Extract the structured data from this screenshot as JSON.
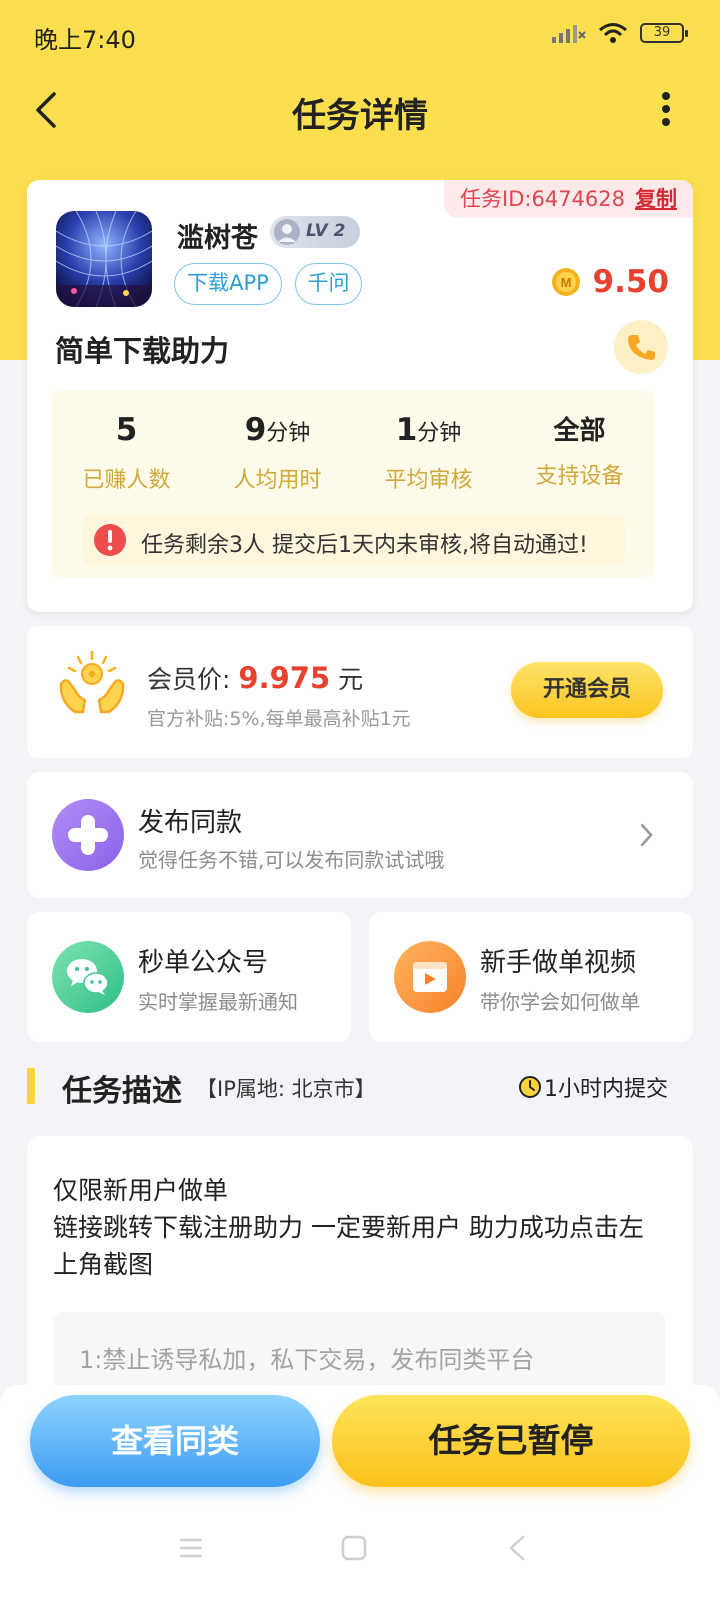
{
  "status_bar": {
    "time": "晚上7:40",
    "battery": "39",
    "icons": [
      "signal-icon",
      "wifi-icon",
      "battery-icon"
    ]
  },
  "nav": {
    "title": "任务详情",
    "back_icon": "back-arrow-icon",
    "more_icon": "more-vertical-icon"
  },
  "task": {
    "id_label": "任务ID:6474628",
    "copy_label": "复制",
    "user_name": "滥树苍",
    "level": "LV 2",
    "tags": [
      "下载APP",
      "千问"
    ],
    "reward_icon": "coin-icon",
    "reward": "9.50",
    "title": "简单下载助力",
    "phone_icon": "phone-icon",
    "stats": [
      {
        "value": "5",
        "unit": "",
        "label": "已赚人数"
      },
      {
        "value": "9",
        "unit": "分钟",
        "label": "人均用时"
      },
      {
        "value": "1",
        "unit": "分钟",
        "label": "平均审核"
      },
      {
        "value": "全部",
        "unit": "",
        "label": "支持设备"
      }
    ],
    "notice": "任务剩余3人  提交后1天内未审核,将自动通过!"
  },
  "member": {
    "price_prefix": "会员价:",
    "price": "9.975",
    "price_unit": "元",
    "subsidy": "官方补贴:5%,每单最高补贴1元",
    "button": "开通会员"
  },
  "publish": {
    "title": "发布同款",
    "subtitle": "觉得任务不错,可以发布同款试试哦"
  },
  "wechat_card": {
    "title": "秒单公众号",
    "subtitle": "实时掌握最新通知"
  },
  "video_card": {
    "title": "新手做单视频",
    "subtitle": "带你学会如何做单"
  },
  "description": {
    "section_title": "任务描述",
    "ip_location": "【IP属地: 北京市】",
    "deadline": "1小时内提交",
    "text_line1": "仅限新用户做单",
    "text_line2": "链接跳转下载注册助力 一定要新用户 助力成功点击左上角截图",
    "rules_preview": "1:禁止诱导私加，私下交易，发布同类平台"
  },
  "bottom": {
    "similar_button": "查看同类",
    "status_button": "任务已暂停"
  },
  "colors": {
    "brand_yellow": "#fbdf4f",
    "reward_red": "#e8412f",
    "tag_blue": "#2e9fd6",
    "stat_gold": "#d0a93a"
  }
}
